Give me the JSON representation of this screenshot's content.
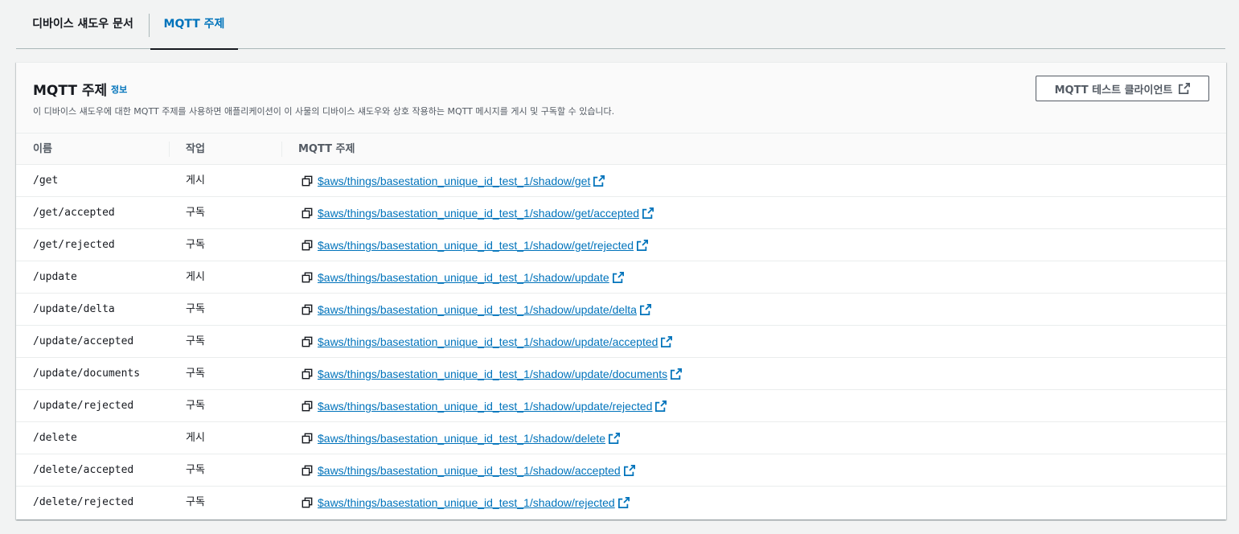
{
  "tabs": [
    {
      "label": "디바이스 섀도우 문서",
      "active": false
    },
    {
      "label": "MQTT 주제",
      "active": true
    }
  ],
  "panel": {
    "title": "MQTT 주제",
    "info_label": "정보",
    "description": "이 디바이스 섀도우에 대한 MQTT 주제를 사용하면 애플리케이션이 이 사물의 디바이스 섀도우와 상호 작용하는 MQTT 메시지를 게시 및 구독할 수 있습니다.",
    "test_client_button": "MQTT 테스트 클라이언트"
  },
  "table": {
    "columns": [
      "이름",
      "작업",
      "MQTT 주제"
    ],
    "rows": [
      {
        "name": "/get",
        "operation": "게시",
        "topic": "$aws/things/basestation_unique_id_test_1/shadow/get"
      },
      {
        "name": "/get/accepted",
        "operation": "구독",
        "topic": "$aws/things/basestation_unique_id_test_1/shadow/get/accepted"
      },
      {
        "name": "/get/rejected",
        "operation": "구독",
        "topic": "$aws/things/basestation_unique_id_test_1/shadow/get/rejected"
      },
      {
        "name": "/update",
        "operation": "게시",
        "topic": "$aws/things/basestation_unique_id_test_1/shadow/update"
      },
      {
        "name": "/update/delta",
        "operation": "구독",
        "topic": "$aws/things/basestation_unique_id_test_1/shadow/update/delta"
      },
      {
        "name": "/update/accepted",
        "operation": "구독",
        "topic": "$aws/things/basestation_unique_id_test_1/shadow/update/accepted"
      },
      {
        "name": "/update/documents",
        "operation": "구독",
        "topic": "$aws/things/basestation_unique_id_test_1/shadow/update/documents"
      },
      {
        "name": "/update/rejected",
        "operation": "구독",
        "topic": "$aws/things/basestation_unique_id_test_1/shadow/update/rejected"
      },
      {
        "name": "/delete",
        "operation": "게시",
        "topic": "$aws/things/basestation_unique_id_test_1/shadow/delete"
      },
      {
        "name": "/delete/accepted",
        "operation": "구독",
        "topic": "$aws/things/basestation_unique_id_test_1/shadow/accepted"
      },
      {
        "name": "/delete/rejected",
        "operation": "구독",
        "topic": "$aws/things/basestation_unique_id_test_1/shadow/rejected"
      }
    ]
  },
  "icons": {
    "copy": "copy-icon",
    "external_link": "external-link-icon"
  },
  "colors": {
    "link": "#0073bb",
    "active_tab_underline": "#16191f",
    "background": "#f2f3f3"
  }
}
